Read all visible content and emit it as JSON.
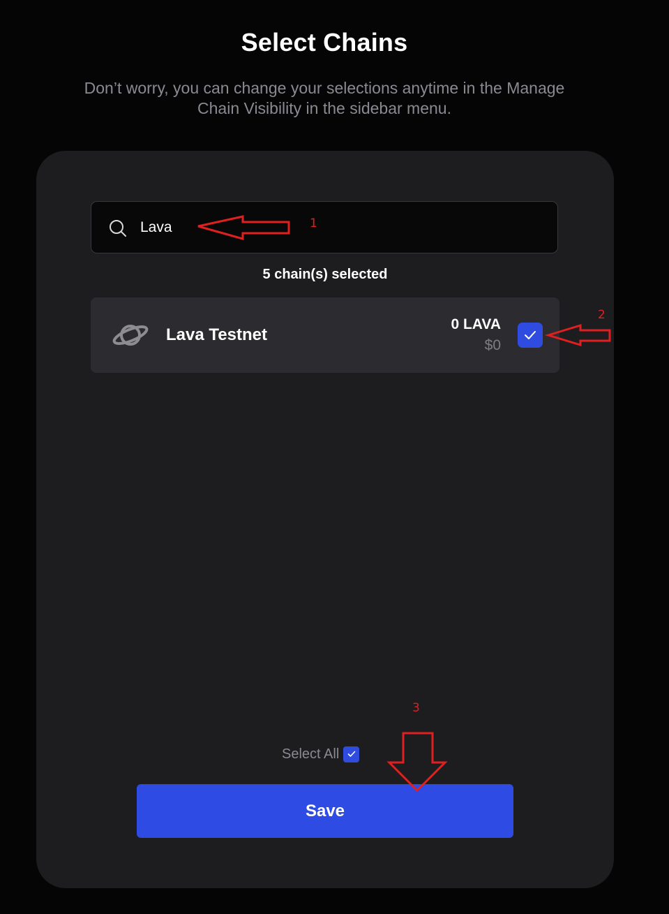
{
  "header": {
    "title": "Select Chains",
    "subtitle": "Don’t worry, you can change your selections anytime in the Manage Chain Visibility in the sidebar menu."
  },
  "search": {
    "value": "Lava",
    "icon": "search-icon"
  },
  "selection": {
    "count_text": "5 chain(s) selected"
  },
  "chains": [
    {
      "name": "Lava Testnet",
      "icon": "planet-icon",
      "balance": "0 LAVA",
      "usd_value": "$0",
      "checked": true
    }
  ],
  "footer": {
    "select_all_label": "Select All",
    "select_all_checked": true,
    "save_label": "Save"
  },
  "annotations": {
    "step_1": "1",
    "step_2": "2",
    "step_3": "3",
    "color": "#e02020"
  },
  "colors": {
    "background": "#050505",
    "panel": "#1d1d1f",
    "row": "#2c2c30",
    "accent": "#2e4be3",
    "muted_text": "#8a8a92"
  }
}
